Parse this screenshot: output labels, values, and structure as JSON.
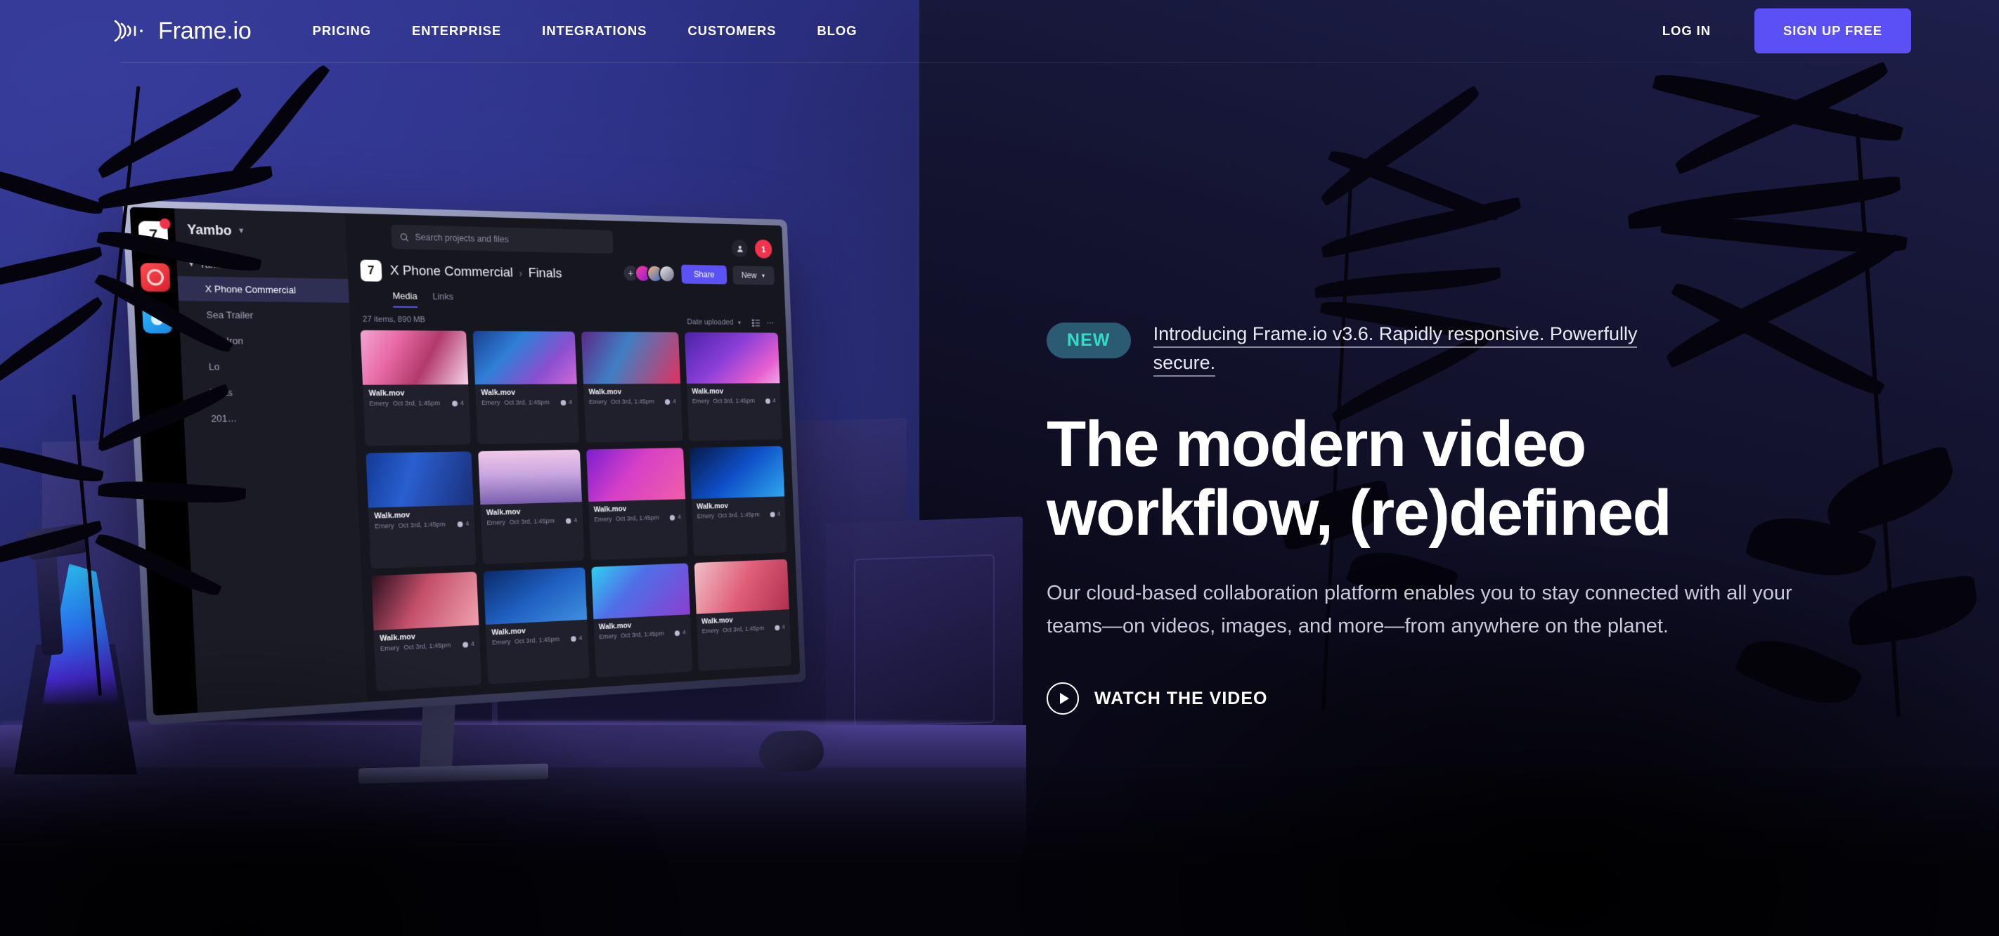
{
  "header": {
    "brand": {
      "name": "Frame.io",
      "logo_icon": "frameio-waveform-logo"
    },
    "nav": [
      {
        "label": "PRICING"
      },
      {
        "label": "ENTERPRISE"
      },
      {
        "label": "INTEGRATIONS"
      },
      {
        "label": "CUSTOMERS"
      },
      {
        "label": "BLOG"
      }
    ],
    "login_label": "LOG IN",
    "signup_label": "SIGN UP FREE",
    "signup_color": "#5a50f5"
  },
  "hero": {
    "badge": "NEW",
    "badge_bg": "#2b5b72",
    "badge_color": "#34dcc6",
    "eyebrow": "Introducing Frame.io v3.6. Rapidly responsive. Powerfully secure.",
    "headline": "The modern video workflow, (re)defined",
    "subcopy": "Our cloud-based collaboration platform enables you to stay connected with all your teams—on videos, images, and more—from anywhere on the planet.",
    "watch_label": "WATCH THE VIDEO",
    "watch_icon": "play-circle-icon"
  },
  "app": {
    "dock": [
      {
        "icon": "frameio-app-icon",
        "badge": true
      },
      {
        "icon": "red-app-icon",
        "badge": false
      },
      {
        "icon": "blue-app-icon",
        "badge": false
      }
    ],
    "sidebar": {
      "team": "Yambo",
      "team_caret_icon": "chevron-down-icon",
      "group": "Yambo Studio",
      "items": [
        {
          "label": "X Phone Commercial",
          "active": true
        },
        {
          "label": "Sea Trailer",
          "active": false
        },
        {
          "label": "Flat Iron",
          "active": false
        },
        {
          "label": "Lo",
          "active": false
        },
        {
          "label": "Tests",
          "active": false
        },
        {
          "label": "201…",
          "active": false
        }
      ]
    },
    "search_placeholder": "Search projects and files",
    "search_icon": "search-icon",
    "breadcrumb": {
      "project": "X Phone Commercial",
      "separator": "›",
      "folder": "Finals",
      "logo": "7"
    },
    "tabs": [
      {
        "label": "Media",
        "active": true
      },
      {
        "label": "Links",
        "active": false
      }
    ],
    "actions": {
      "add_member_icon": "add-member-icon",
      "share_label": "Share",
      "new_label": "New",
      "new_caret_icon": "chevron-down-icon",
      "person_icon": "person-icon",
      "notification_count": "1"
    },
    "meta": {
      "item_count": "27 items, 890 MB",
      "sort_label": "Date uploaded",
      "sort_caret_icon": "chevron-down-icon",
      "list_view_icon": "list-view-icon",
      "more_icon": "more-horizontal-icon"
    },
    "tiles": [
      {
        "name": "Walk.mov",
        "owner": "Emery",
        "date": "Oct 3rd, 1:45pm",
        "comments": "4",
        "thumb": "linear-gradient(120deg,#f2a6d2 0%,#e86aa6 30%,#b23a6a 60%,#f7d4ea 100%)"
      },
      {
        "name": "Walk.mov",
        "owner": "Emery",
        "date": "Oct 3rd, 1:45pm",
        "comments": "4",
        "thumb": "linear-gradient(135deg,#1a3f8f 0%,#2f7fd8 35%,#8a4fd0 70%,#d06ad8 100%)"
      },
      {
        "name": "Walk.mov",
        "owner": "Emery",
        "date": "Oct 3rd, 1:45pm",
        "comments": "4",
        "thumb": "linear-gradient(120deg,#5a2a86 0%,#3f7fc4 40%,#e0325f 100%)"
      },
      {
        "name": "Walk.mov",
        "owner": "Emery",
        "date": "Oct 3rd, 1:45pm",
        "comments": "4",
        "thumb": "linear-gradient(140deg,#4a22a8 0%,#8b3fd8 45%,#e85fd0 80%,#f0a8e8 100%)"
      },
      {
        "name": "Walk.mov",
        "owner": "Emery",
        "date": "Oct 3rd, 1:45pm",
        "comments": "4",
        "thumb": "linear-gradient(110deg,#123a96 0%,#2a5fd0 40%,#1a2f7a 100%)"
      },
      {
        "name": "Walk.mov",
        "owner": "Emery",
        "date": "Oct 3rd, 1:45pm",
        "comments": "4",
        "thumb": "linear-gradient(180deg,#f0c8ea 0%,#c9a6e0 45%,#7a5fb0 100%)"
      },
      {
        "name": "Walk.mov",
        "owner": "Emery",
        "date": "Oct 3rd, 1:45pm",
        "comments": "4",
        "thumb": "linear-gradient(130deg,#7a1fd0 0%,#d63fc8 45%,#f05fa8 100%)"
      },
      {
        "name": "Walk.mov",
        "owner": "Emery",
        "date": "Oct 3rd, 1:45pm",
        "comments": "4",
        "thumb": "linear-gradient(140deg,#061a4a 0%,#0f4fc8 50%,#2fa8f0 100%)"
      },
      {
        "name": "Walk.mov",
        "owner": "Emery",
        "date": "Oct 3rd, 1:45pm",
        "comments": "4",
        "thumb": "linear-gradient(120deg,#2a1020 0%,#c4506a 45%,#f0a0b0 100%)"
      },
      {
        "name": "Walk.mov",
        "owner": "Emery",
        "date": "Oct 3rd, 1:45pm",
        "comments": "4",
        "thumb": "linear-gradient(150deg,#0a2a6a 0%,#1f5fc0 50%,#3f8fe0 100%)"
      },
      {
        "name": "Walk.mov",
        "owner": "Emery",
        "date": "Oct 3rd, 1:45pm",
        "comments": "4",
        "thumb": "linear-gradient(135deg,#2fd0f0 0%,#4f6fe8 40%,#8b3fd0 100%)"
      },
      {
        "name": "Walk.mov",
        "owner": "Emery",
        "date": "Oct 3rd, 1:45pm",
        "comments": "4",
        "thumb": "linear-gradient(120deg,#f0c0c8 0%,#e0607a 50%,#b03050 100%)"
      }
    ]
  }
}
